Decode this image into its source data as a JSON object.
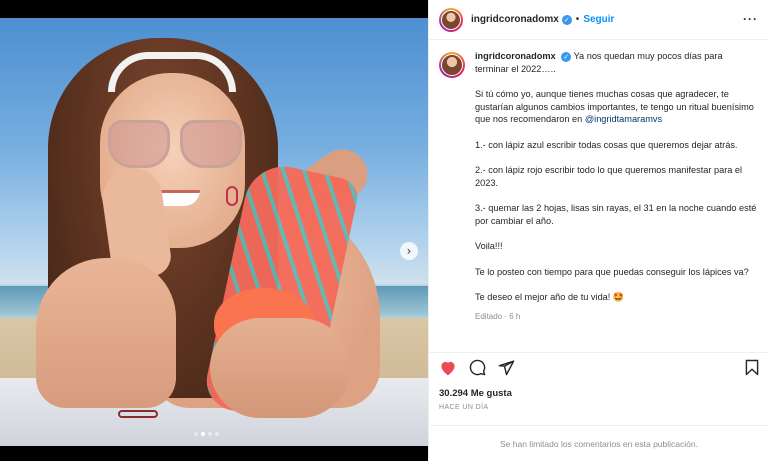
{
  "post": {
    "username": "ingridcoronadomx",
    "follow_label": "Seguir",
    "separator": "•",
    "more_label": "···",
    "caption": {
      "intro": "Ya nos quedan muy pocos días para terminar el 2022…..",
      "para1_text": "Si tú cómo yo, aunque tienes muchas cosas que agradecer, te gustarían algunos cambios importantes, te tengo un ritual buenísimo que nos recomendaron en",
      "para1_mention": "@ingridtamaramvs",
      "para2": "1.- con lápiz azul escribir todas cosas que queremos dejar atrás.",
      "para3": "2.- con lápiz rojo escribir todo lo que queremos manifestar para el 2023.",
      "para4": "3.- quemar las 2 hojas, lisas sin rayas, el 31 en la noche cuando esté por cambiar el año.",
      "para5": "Voila!!!",
      "para6": "Te lo posteo con tiempo para que puedas conseguir los lápices va?",
      "para7": "Te deseo el mejor año de tu vida! 🤩",
      "edited": "Editado · 6 h"
    },
    "likes": "30.294 Me gusta",
    "date": "HACE UN DÍA",
    "comments_off": "Se han limitado los comentarios en esta publicación."
  },
  "media": {
    "next_label": "›",
    "dots": 4,
    "active_dot": 1
  },
  "icons": {
    "like": "heart-icon",
    "comment": "comment-icon",
    "share": "share-icon",
    "save": "bookmark-icon",
    "verified": "verified-badge-icon"
  },
  "colors": {
    "like_red": "#ed4956",
    "link_blue": "#0095f6",
    "verified_blue": "#3897f0"
  }
}
